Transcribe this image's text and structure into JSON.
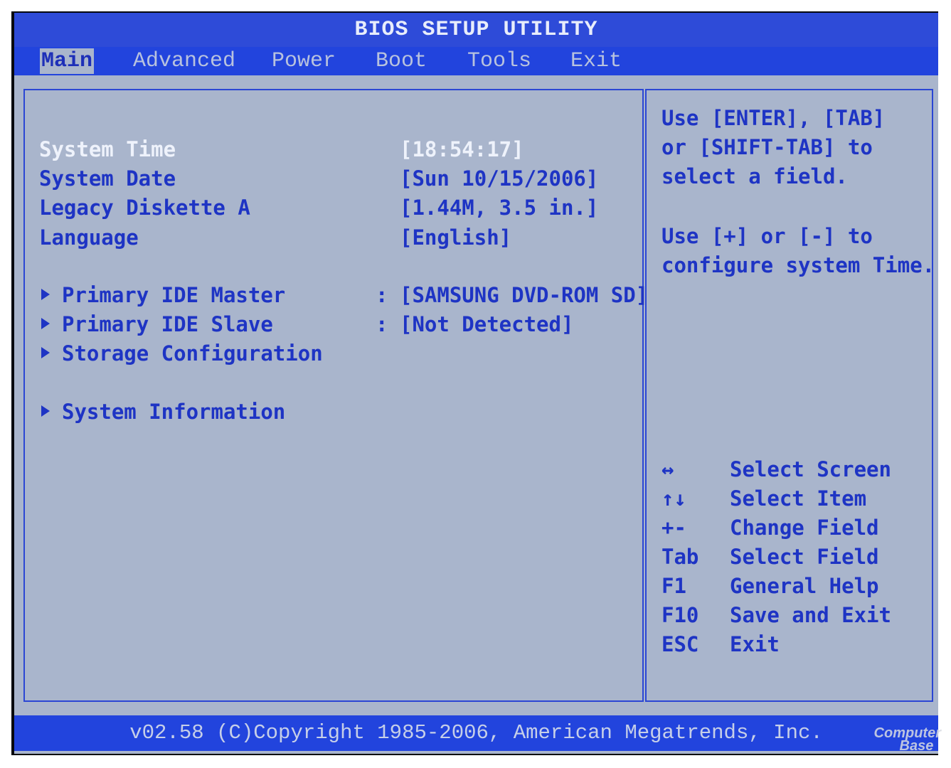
{
  "title": "BIOS SETUP UTILITY",
  "menu": {
    "tabs": [
      {
        "label": "Main",
        "active": true
      },
      {
        "label": "Advanced"
      },
      {
        "label": "Power"
      },
      {
        "label": "Boot"
      },
      {
        "label": "Tools"
      },
      {
        "label": "Exit"
      }
    ]
  },
  "settings": [
    {
      "label": "System Time",
      "value": "[18:54:17]",
      "highlight": true
    },
    {
      "label": "System Date",
      "value": "[Sun 10/15/2006]"
    },
    {
      "label": "Legacy Diskette A",
      "value": "[1.44M, 3.5 in.]"
    },
    {
      "label": "Language",
      "value": "[English]"
    }
  ],
  "submenus": [
    {
      "label": "Primary IDE Master",
      "separator": ":",
      "value": "[SAMSUNG DVD-ROM SD]",
      "icon": "arrow-right-icon"
    },
    {
      "label": "Primary IDE Slave",
      "separator": ":",
      "value": "[Not Detected]",
      "icon": "arrow-right-icon"
    },
    {
      "label": "Storage Configuration",
      "icon": "arrow-right-icon"
    },
    {
      "label": "System Information",
      "icon": "arrow-right-icon"
    }
  ],
  "help": {
    "text1": "Use [ENTER], [TAB]\nor [SHIFT-TAB] to\nselect a field.",
    "text2": "Use [+] or [-] to\nconfigure system Time."
  },
  "keys": [
    {
      "key": "↔",
      "desc": "Select Screen"
    },
    {
      "key": "↑↓",
      "desc": "Select Item"
    },
    {
      "key": "+-",
      "desc": "Change Field"
    },
    {
      "key": "Tab",
      "desc": "Select Field"
    },
    {
      "key": "F1",
      "desc": "General Help"
    },
    {
      "key": "F10",
      "desc": "Save and Exit"
    },
    {
      "key": "ESC",
      "desc": "Exit"
    }
  ],
  "footer": "v02.58 (C)Copyright 1985-2006, American Megatrends, Inc.",
  "watermark": {
    "line1": "Computer",
    "line2": "Base"
  },
  "colors": {
    "background": "#a9b5cc",
    "bar": "#2244dd",
    "text": "#1e34c4",
    "highlight": "#eef2fb"
  }
}
